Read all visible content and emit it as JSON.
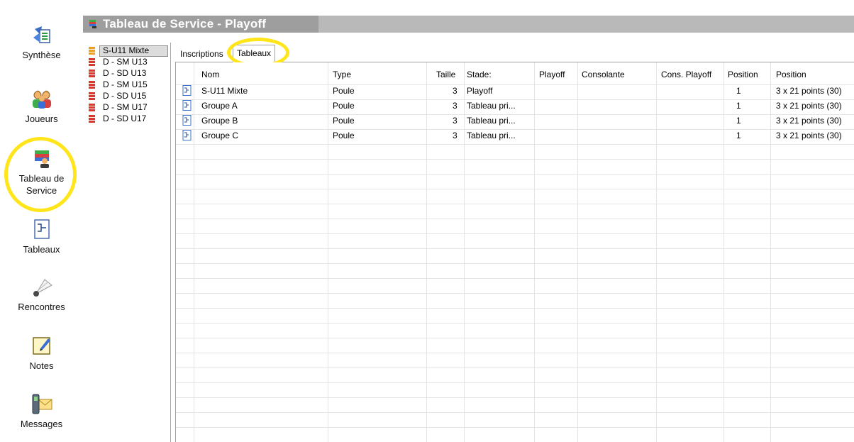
{
  "window": {
    "title": "Tableau de Service - Playoff"
  },
  "nav": {
    "items": [
      {
        "label": "Synthèse",
        "icon": "synthesis-icon"
      },
      {
        "label": "Joueurs",
        "icon": "players-icon"
      },
      {
        "label": "Tableau de Service",
        "icon": "control-desk-icon"
      },
      {
        "label": "Tableaux",
        "icon": "draws-icon"
      },
      {
        "label": "Rencontres",
        "icon": "shuttlecock-icon"
      },
      {
        "label": "Notes",
        "icon": "notes-icon"
      },
      {
        "label": "Messages",
        "icon": "messages-icon"
      }
    ]
  },
  "draws": {
    "items": [
      {
        "label": "S-U11 Mixte",
        "color": "#f0a020"
      },
      {
        "label": "D - SM U13",
        "color": "#d63a2a"
      },
      {
        "label": "D - SD U13",
        "color": "#d63a2a"
      },
      {
        "label": "D - SM U15",
        "color": "#d63a2a"
      },
      {
        "label": "D - SD U15",
        "color": "#d63a2a"
      },
      {
        "label": "D - SM U17",
        "color": "#d63a2a"
      },
      {
        "label": "D - SD U17",
        "color": "#d63a2a"
      }
    ]
  },
  "tabs": [
    {
      "label": "Inscriptions"
    },
    {
      "label": "Tableaux"
    }
  ],
  "table": {
    "headers": {
      "nom": "Nom",
      "type": "Type",
      "taille": "Taille",
      "stade": "Stade:",
      "playoff": "Playoff",
      "consolante": "Consolante",
      "cons_playoff": "Cons. Playoff",
      "position": "Position",
      "position2": "Position"
    },
    "rows": [
      {
        "nom": "S-U11 Mixte",
        "type": "Poule",
        "taille": "3",
        "stade": "Playoff",
        "position": "1",
        "position2": "3 x 21 points (30)"
      },
      {
        "nom": "Groupe A",
        "type": "Poule",
        "taille": "3",
        "stade": "Tableau pri...",
        "position": "1",
        "position2": "3 x 21 points (30)"
      },
      {
        "nom": "Groupe B",
        "type": "Poule",
        "taille": "3",
        "stade": "Tableau pri...",
        "position": "1",
        "position2": "3 x 21 points (30)"
      },
      {
        "nom": "Groupe C",
        "type": "Poule",
        "taille": "3",
        "stade": "Tableau pri...",
        "position": "1",
        "position2": "3 x 21 points (30)"
      }
    ]
  },
  "colors": {
    "highlight": "#ffe51a",
    "titlebar": "#b9b9b9"
  }
}
